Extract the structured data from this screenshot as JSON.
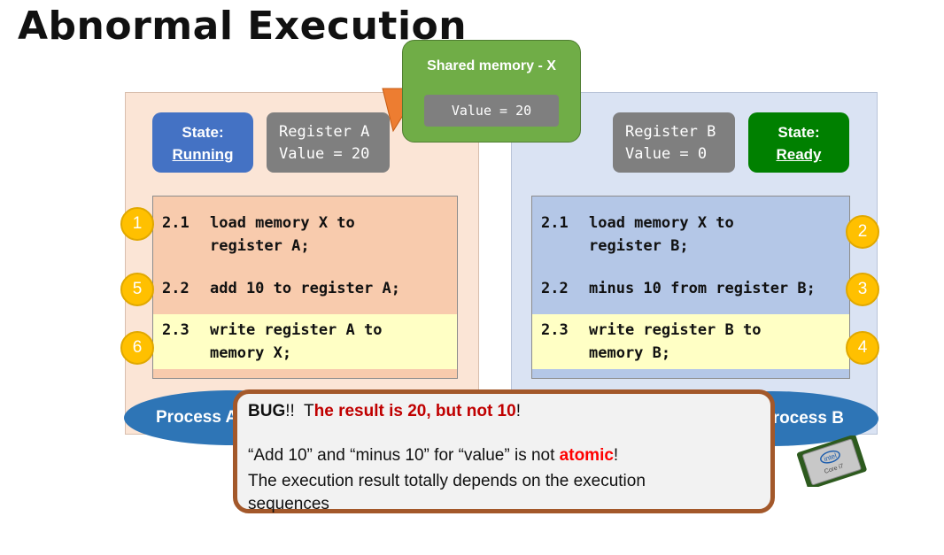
{
  "title": "Abnormal Execution",
  "shared_memory": {
    "title": "Shared memory - X",
    "value": "Value = 20"
  },
  "process_a": {
    "label": "Process A",
    "state_label": "State:",
    "state_value": "Running",
    "register_name": "Register A",
    "register_value": "Value = 20",
    "lines": [
      {
        "step": "1",
        "num": "2.1",
        "text": "load memory X to",
        "cont": "register A;"
      },
      {
        "step": "5",
        "num": "2.2",
        "text": "add 10 to register A;",
        "cont": ""
      },
      {
        "step": "6",
        "num": "2.3",
        "text": "write register A to",
        "cont": "memory X;"
      }
    ]
  },
  "process_b": {
    "label": "Process B",
    "state_label": "State:",
    "state_value": "Ready",
    "register_name": "Register B",
    "register_value": "Value = 0",
    "lines": [
      {
        "step": "2",
        "num": "2.1",
        "text": "load memory X to",
        "cont": "register B;"
      },
      {
        "step": "3",
        "num": "2.2",
        "text": "minus 10 from register B;",
        "cont": ""
      },
      {
        "step": "4",
        "num": "2.3",
        "text": "write register B to",
        "cont": "memory B;"
      }
    ]
  },
  "bug_note": {
    "bug": "BUG",
    "excl": "!!",
    "t_plain": "T",
    "result": "he result is 20, but not 10",
    "excl2": "!",
    "line2_a": "“Add 10” and “minus 10” for “value” is not ",
    "line2_b": "atomic",
    "line2_c": "!",
    "line3": "The execution result totally depends on the execution sequences"
  },
  "chip": {
    "brand": "intel",
    "model": "Core i7"
  },
  "colors": {
    "running": "#4472c4",
    "ready": "#008000",
    "process": "#2e75b6",
    "badge": "#ffc000",
    "shared": "#70ad47",
    "arrow": "#ed7d31",
    "bug_border": "#a3582a",
    "bug_red": "#c00000"
  }
}
